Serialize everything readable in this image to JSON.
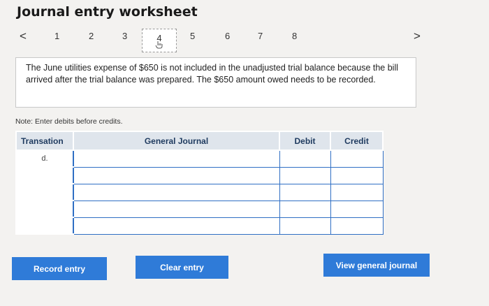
{
  "page": {
    "title": "Journal entry worksheet"
  },
  "pager": {
    "prev": "<",
    "next": ">",
    "pages": [
      "1",
      "2",
      "3",
      "4",
      "5",
      "6",
      "7",
      "8"
    ],
    "active": "4"
  },
  "description": "The June utilities expense of $650 is not included in the unadjusted trial balance because the bill arrived after the trial balance was prepared. The $650 amount owed needs to be recorded.",
  "note": "Note: Enter debits before credits.",
  "table": {
    "headers": {
      "transaction": "Transation",
      "journal": "General Journal",
      "debit": "Debit",
      "credit": "Credit"
    },
    "rows": [
      {
        "transaction": "d."
      },
      {
        "transaction": ""
      },
      {
        "transaction": ""
      },
      {
        "transaction": ""
      },
      {
        "transaction": ""
      }
    ]
  },
  "buttons": {
    "record": "Record entry",
    "clear": "Clear entry",
    "view": "View general journal"
  }
}
